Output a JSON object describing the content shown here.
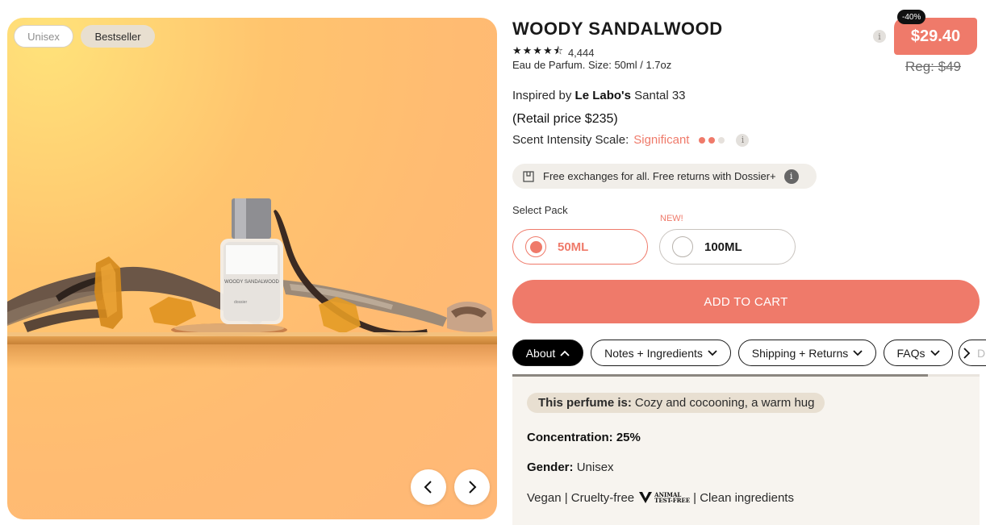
{
  "gallery": {
    "badges": [
      "Unisex",
      "Bestseller"
    ],
    "bottle_label": "WOODY SANDALWOOD",
    "bottle_brand": "dossier"
  },
  "product": {
    "title": "WOODY SANDALWOOD",
    "stars": "★★★★⯪",
    "rating_value": 4.5,
    "review_count": "4,444",
    "subline": "Eau de Parfum. Size: 50ml / 1.7oz",
    "inspired_prefix": "Inspired by",
    "inspired_brand": "Le Labo's",
    "inspired_name": "Santal 33",
    "retail": "(Retail price $235)",
    "scent_label": "Scent Intensity Scale:",
    "scent_level": "Significant",
    "scent_dots_filled": 2,
    "scent_dots_total": 3
  },
  "price": {
    "discount": "-40%",
    "current": "$29.40",
    "regular": "Reg: $49",
    "info": "i"
  },
  "exchange": {
    "text": "Free exchanges for all. Free returns with Dossier+"
  },
  "pack": {
    "label": "Select Pack",
    "new_tag": "NEW!",
    "options": [
      {
        "label": "50ML",
        "selected": true
      },
      {
        "label": "100ML",
        "selected": false
      }
    ]
  },
  "cart": {
    "label": "ADD TO CART"
  },
  "tabs": [
    {
      "label": "About",
      "active": true
    },
    {
      "label": "Notes + Ingredients",
      "active": false
    },
    {
      "label": "Shipping + Returns",
      "active": false
    },
    {
      "label": "FAQs",
      "active": false
    },
    {
      "label": "D",
      "active": false
    }
  ],
  "about": {
    "feel_label": "This perfume is:",
    "feel_value": "Cozy and cocooning, a warm hug",
    "concentration_label": "Concentration:",
    "concentration_value": "25%",
    "gender_label": "Gender:",
    "gender_value": "Unisex",
    "claims_left": "Vegan | Cruelty-free",
    "claims_right": "| Clean ingredients",
    "badge_text_1": "ANIMAL",
    "badge_text_2": "TEST-FREE"
  },
  "colors": {
    "accent": "#ef7a6a",
    "dark": "#1a1a1a",
    "panel": "#f7f4ef"
  },
  "icons": {
    "prev": "chevron-left-icon",
    "next": "chevron-right-icon",
    "exchange": "box-icon",
    "tab_open": "chevron-up-icon",
    "tab_closed": "chevron-down-icon"
  }
}
